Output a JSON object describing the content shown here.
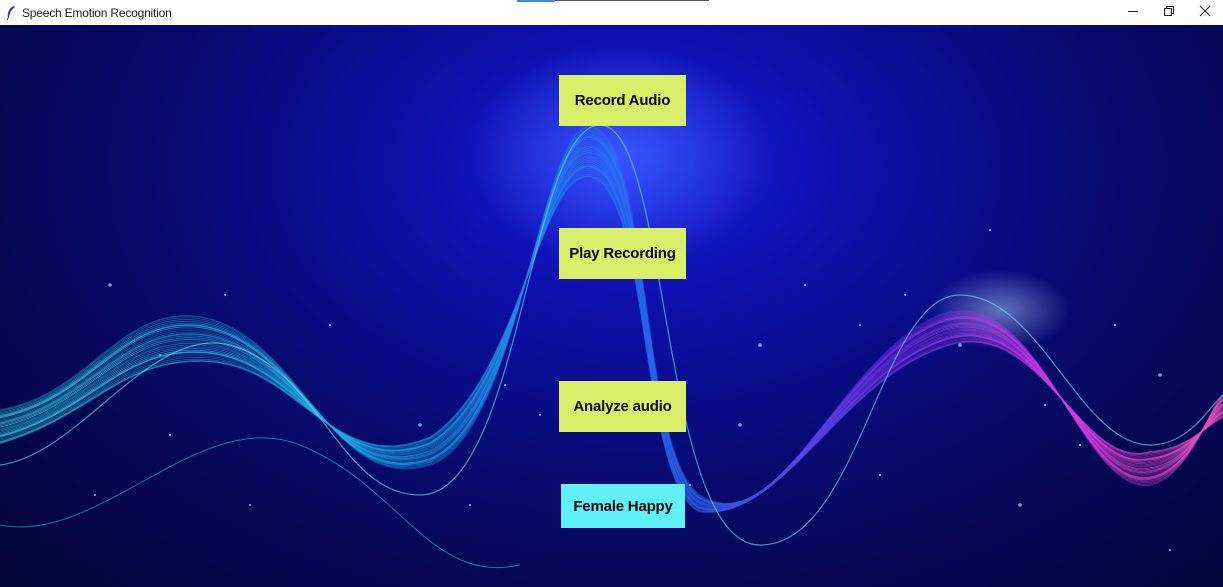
{
  "window": {
    "title": "Speech Emotion Recognition",
    "app_icon": "feather-icon",
    "controls": {
      "minimize_icon": "minimize-icon",
      "restore_icon": "restore-icon",
      "close_icon": "close-icon"
    }
  },
  "buttons": {
    "record_label": "Record Audio",
    "play_label": "Play Recording",
    "analyze_label": "Analyze audio",
    "result_label": "Female Happy"
  },
  "colors": {
    "button_yellow": "#d9ef6a",
    "result_cyan": "#5ff0f8",
    "background_navy": "#070a6a",
    "wave_cyan": "#2fe6f2",
    "wave_magenta": "#e23cf0"
  }
}
